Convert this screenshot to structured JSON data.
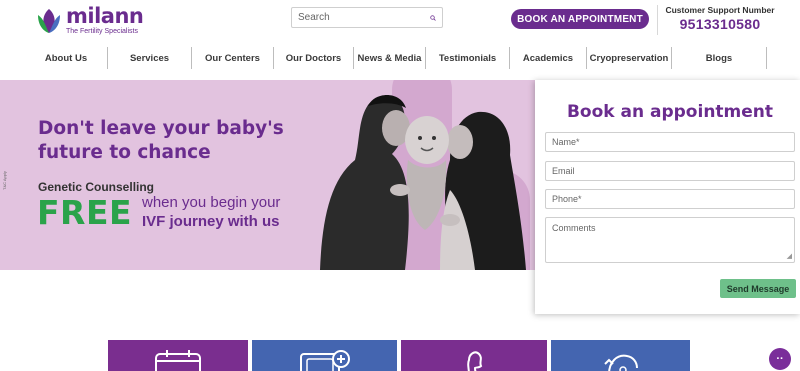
{
  "brand": {
    "name": "milann",
    "tagline": "The Fertility Specialists",
    "colors": {
      "primary": "#6a2c8e",
      "green": "#2aa34a",
      "hero_bg": "#e2c3df",
      "send": "#6ec08a"
    }
  },
  "header": {
    "search_placeholder": "Search",
    "search_icon": "search-icon",
    "book_button": "BOOK AN APPOINTMENT",
    "support_label": "Customer Support Number",
    "support_phone": "9513310580"
  },
  "nav": {
    "items": [
      {
        "label": "About Us"
      },
      {
        "label": "Services"
      },
      {
        "label": "Our Centers"
      },
      {
        "label": "Our Doctors"
      },
      {
        "label": "News & Media"
      },
      {
        "label": "Testimonials"
      },
      {
        "label": "Academics"
      },
      {
        "label": "Cryopreservation"
      },
      {
        "label": "Blogs"
      }
    ]
  },
  "hero": {
    "title": "Don't leave your baby's future to chance",
    "subtitle": "Genetic Counselling",
    "free": "FREE",
    "line1": "when you begin your",
    "line2": "IVF journey with us",
    "small_print": "T&C Apply"
  },
  "form": {
    "title": "Book an appointment",
    "name_placeholder": "Name*",
    "email_placeholder": "Email",
    "phone_placeholder": "Phone*",
    "comments_placeholder": "Comments",
    "send_button": "Send Message"
  },
  "tiles": [
    {
      "icon": "calendar-icon",
      "color": "#7a2e8f"
    },
    {
      "icon": "medical-kit-icon",
      "color": "#4465b0"
    },
    {
      "icon": "woman-profile-icon",
      "color": "#7a2e8f"
    },
    {
      "icon": "refresh-icon",
      "color": "#4465b0"
    }
  ],
  "chat": {
    "icon": "chat-icon",
    "label": "··"
  }
}
